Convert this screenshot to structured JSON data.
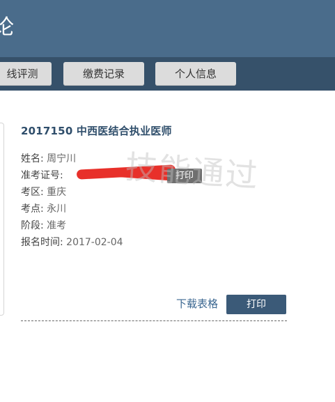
{
  "header": {
    "title_fragment": "论"
  },
  "nav": {
    "tabs": [
      {
        "label": "线评测"
      },
      {
        "label": "缴费记录"
      },
      {
        "label": "个人信息"
      }
    ]
  },
  "exam": {
    "title": "2017150 中西医结合执业医师",
    "fields": [
      {
        "label": "姓名:",
        "value": "周宁川"
      },
      {
        "label": "准考证号:",
        "value": ""
      },
      {
        "label": "考区:",
        "value": "重庆"
      },
      {
        "label": "考点:",
        "value": "永川"
      },
      {
        "label": "阶段:",
        "value": "准考"
      },
      {
        "label": "报名时间:",
        "value": "2017-02-04"
      }
    ],
    "inline_print_label": "打印"
  },
  "watermark": "技能通过",
  "actions": {
    "download_label": "下载表格",
    "print_label": "打印"
  }
}
